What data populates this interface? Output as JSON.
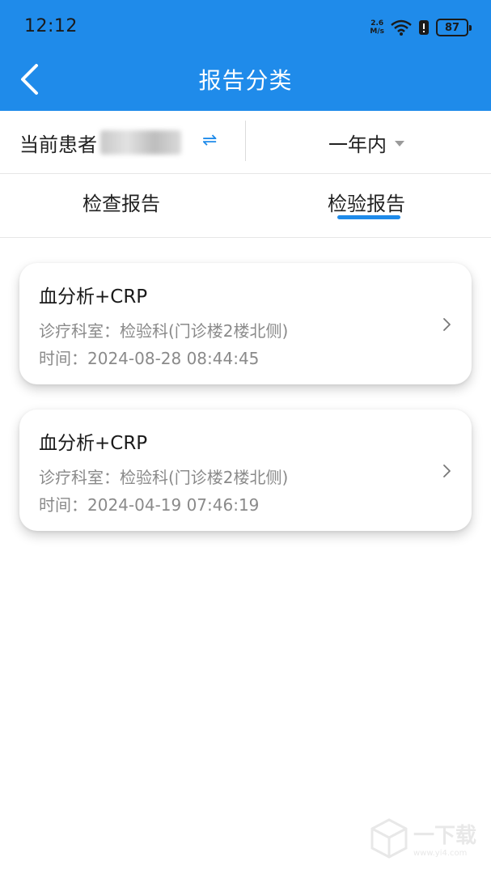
{
  "status": {
    "time": "12:12",
    "net_speed_top": "2.6",
    "net_speed_bottom": "M/s",
    "battery": "87"
  },
  "header": {
    "title": "报告分类"
  },
  "filter": {
    "patient_label": "当前患者",
    "switch_symbol": "⇌",
    "range": "一年内"
  },
  "tabs": [
    {
      "label": "检查报告",
      "active": false
    },
    {
      "label": "检验报告",
      "active": true
    }
  ],
  "reports": [
    {
      "title": "血分析+CRP",
      "dept": "诊疗科室：检验科(门诊楼2楼北侧)",
      "time": "时间：2024-08-28 08:44:45"
    },
    {
      "title": "血分析+CRP",
      "dept": "诊疗科室：检验科(门诊楼2楼北侧)",
      "time": "时间：2024-04-19 07:46:19"
    }
  ],
  "colors": {
    "accent": "#1f8bea"
  },
  "watermark": {
    "text": "一下载",
    "sub": "www.yi4.com"
  }
}
